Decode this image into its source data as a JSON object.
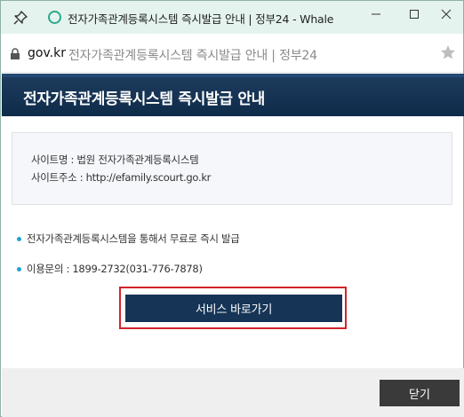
{
  "window": {
    "title": "전자가족관계등록시스템 즉시발급 안내 | 정부24 - Whale"
  },
  "address_bar": {
    "domain": "gov.kr",
    "page_title": "전자가족관계등록시스템 즉시발급 안내 | 정부24"
  },
  "popup": {
    "heading": "전자가족관계등록시스템 즉시발급 안내",
    "info": {
      "site_name": "사이트명 : 법원 전자가족관계등록시스템",
      "site_address": "사이트주소 : http://efamily.scourt.go.kr"
    },
    "bullets": [
      "전자가족관계등록시스템을 통해서 무료로 즉시 발급",
      "이용문의 : 1899-2732(031-776-7878)"
    ],
    "service_button": "서비스 바로가기",
    "close_button": "닫기"
  },
  "colors": {
    "header_bg": "#0f2b4a",
    "button_bg": "#163456",
    "highlight_border": "#d2232a",
    "bullet": "#1ea3d6",
    "titlebar_bg": "#e5f3ee"
  },
  "icons": {
    "pin": "pin-icon",
    "favicon": "whale-favicon-icon",
    "lock": "lock-icon",
    "star": "star-icon",
    "minimize": "minimize-icon",
    "maximize": "maximize-icon",
    "close": "close-icon"
  }
}
